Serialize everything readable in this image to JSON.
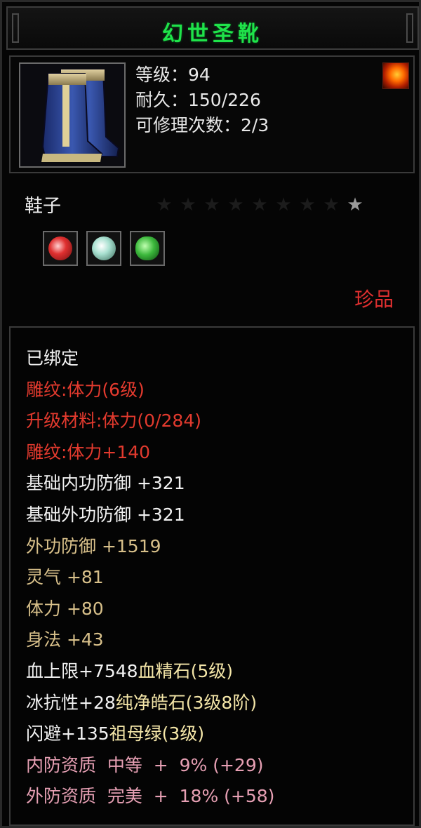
{
  "title": "幻世圣靴",
  "stats": {
    "level": "等级：94",
    "durability": "耐久：150/226",
    "repair": "可修理次数：2/3"
  },
  "icons": {
    "item": "boots-icon",
    "corner": "fire-emblem-icon",
    "gems": [
      "red-gem-icon",
      "white-gem-icon",
      "green-jade-icon"
    ]
  },
  "type_label": "鞋子",
  "stars": {
    "total": 9,
    "lit": 1
  },
  "rarity": "珍品",
  "attributes": [
    {
      "parts": [
        {
          "text": "已绑定",
          "color": "white"
        }
      ]
    },
    {
      "parts": [
        {
          "text": "雕纹:体力(6级)",
          "color": "red"
        }
      ]
    },
    {
      "parts": [
        {
          "text": "升级材料:体力(0/284)",
          "color": "red"
        }
      ]
    },
    {
      "parts": [
        {
          "text": "雕纹:体力+140",
          "color": "red"
        }
      ]
    },
    {
      "parts": [
        {
          "text": "基础内功防御 +321",
          "color": "white"
        }
      ]
    },
    {
      "parts": [
        {
          "text": "基础外功防御 +321",
          "color": "white"
        }
      ]
    },
    {
      "parts": [
        {
          "text": "外功防御 +1519",
          "color": "tan"
        }
      ]
    },
    {
      "parts": [
        {
          "text": "灵气 +81",
          "color": "tan"
        }
      ]
    },
    {
      "parts": [
        {
          "text": "体力 +80",
          "color": "tan"
        }
      ]
    },
    {
      "parts": [
        {
          "text": "身法 +43",
          "color": "tan"
        }
      ]
    },
    {
      "parts": [
        {
          "text": "血上限+7548",
          "color": "white"
        },
        {
          "text": "血精石(5级)",
          "color": "rest"
        }
      ]
    },
    {
      "parts": [
        {
          "text": "冰抗性+28",
          "color": "white"
        },
        {
          "text": "纯净皓石(3级8阶)",
          "color": "rest"
        }
      ]
    },
    {
      "parts": [
        {
          "text": "闪避+135",
          "color": "white"
        },
        {
          "text": "祖母绿(3级)",
          "color": "rest"
        }
      ]
    },
    {
      "parts": [
        {
          "text": "内防资质  中等  +  9% (+29)",
          "color": "pink"
        }
      ]
    },
    {
      "parts": [
        {
          "text": "外防资质  完美  +  18% (+58)",
          "color": "pink"
        }
      ]
    }
  ],
  "colors": {
    "title": "#1fe34a",
    "white": "#f2f2f2",
    "red": "#e33a2e",
    "tan": "#d8c08a",
    "pink": "#e7a0b4",
    "rest": "#f4e6a8"
  }
}
